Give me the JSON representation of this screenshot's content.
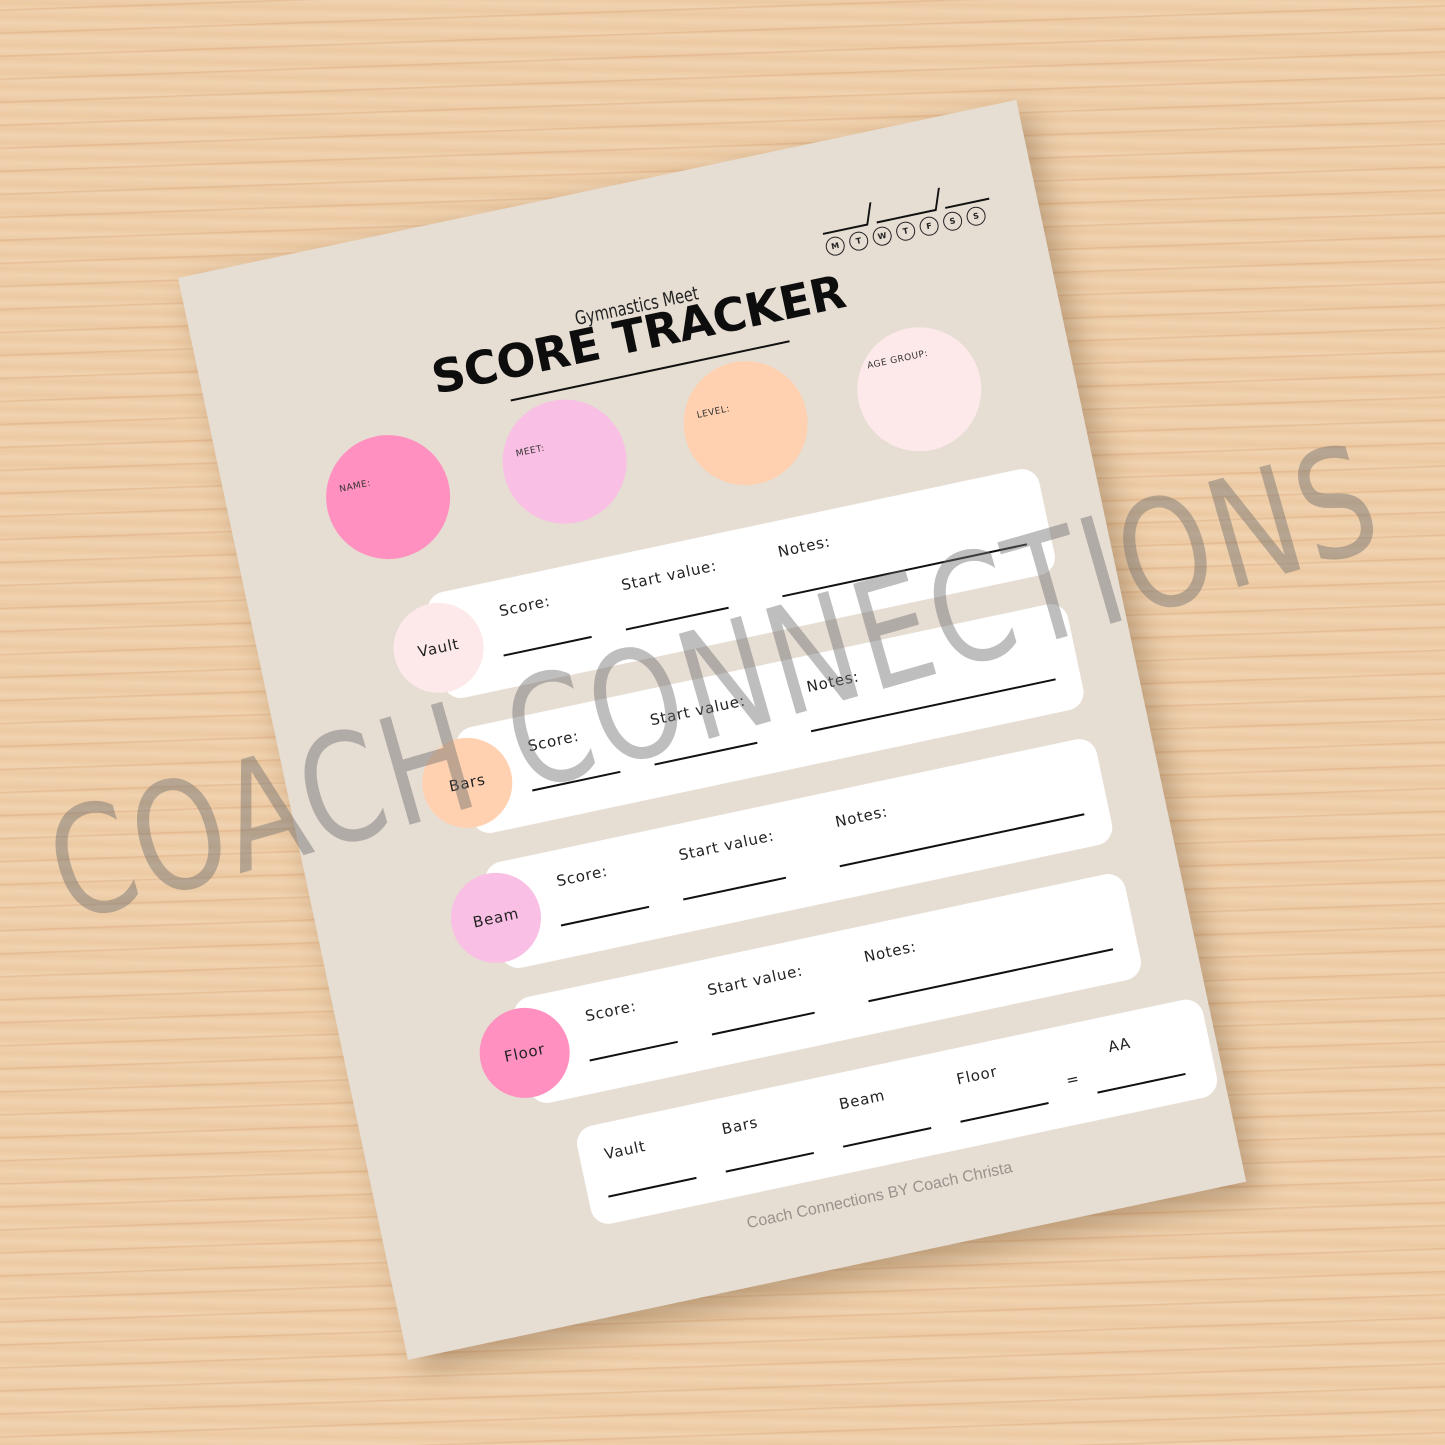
{
  "sheet": {
    "subtitle": "Gymnastics Meet",
    "title": "SCORE TRACKER",
    "date_days": [
      "M",
      "T",
      "W",
      "T",
      "F",
      "S",
      "S"
    ],
    "info_fields": [
      {
        "label": "NAME:",
        "color": "#ff90bf"
      },
      {
        "label": "MEET:",
        "color": "#f9bfe4"
      },
      {
        "label": "LEVEL:",
        "color": "#ffd1b0"
      },
      {
        "label": "AGE GROUP:",
        "color": "#fde8ea"
      }
    ],
    "events": [
      {
        "name": "Vault",
        "color": "#fde8ea",
        "score_label": "Score:",
        "start_label": "Start value:",
        "notes_label": "Notes:"
      },
      {
        "name": "Bars",
        "color": "#ffd1b0",
        "score_label": "Score:",
        "start_label": "Start value:",
        "notes_label": "Notes:"
      },
      {
        "name": "Beam",
        "color": "#f9bfe4",
        "score_label": "Score:",
        "start_label": "Start value:",
        "notes_label": "Notes:"
      },
      {
        "name": "Floor",
        "color": "#ff90bf",
        "score_label": "Score:",
        "start_label": "Start value:",
        "notes_label": "Notes:"
      }
    ],
    "totals": {
      "labels": [
        "Vault",
        "Bars",
        "Beam",
        "Floor"
      ],
      "equals": "=",
      "result_label": "AA"
    },
    "footer": "Coach Connections BY Coach Christa"
  },
  "watermark": "COACH CONNECTIONS"
}
